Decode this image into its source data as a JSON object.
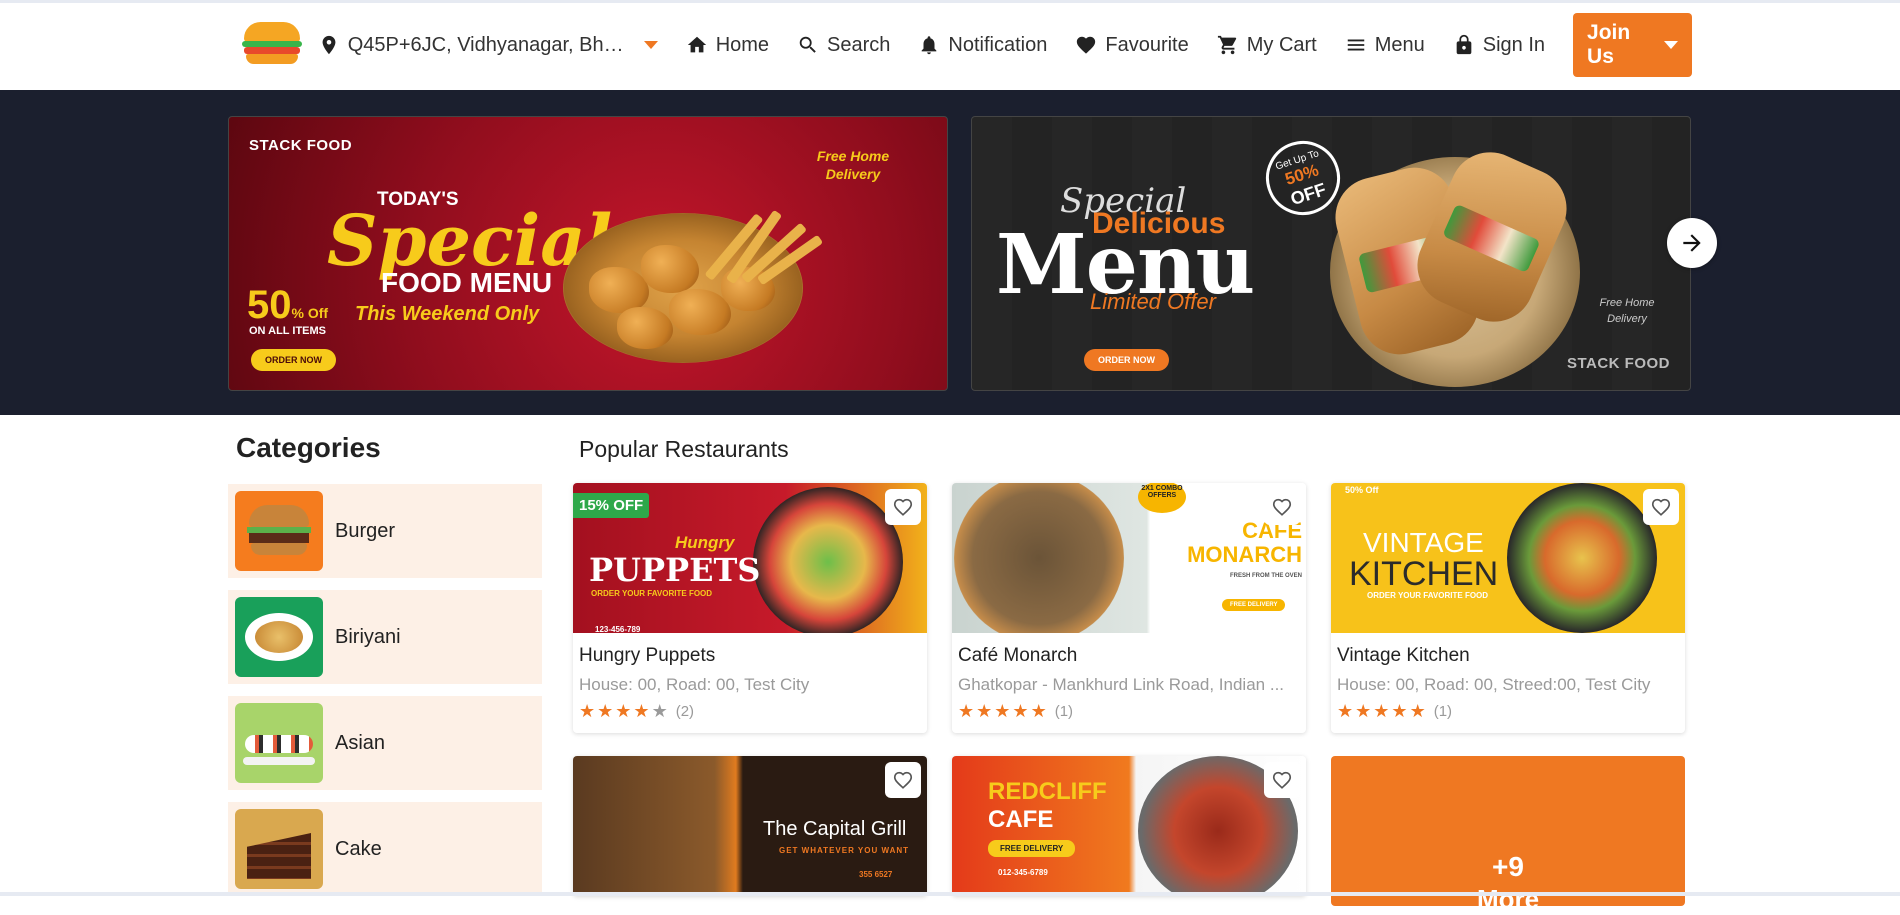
{
  "header": {
    "location": "Q45P+6JC, Vidhyanagar, Bhav...",
    "nav": {
      "home": "Home",
      "search": "Search",
      "notification": "Notification",
      "favourite": "Favourite",
      "cart": "My Cart",
      "menu": "Menu",
      "signin": "Sign In"
    },
    "join_label": "Join Us"
  },
  "banners": [
    {
      "brand": "STACK FOOD",
      "today": "TODAY'S",
      "special": "Special",
      "food_menu": "FOOD MENU",
      "weekend": "This Weekend Only",
      "discount": "50",
      "discount_suffix": "% Off",
      "all_items": "ON ALL ITEMS",
      "order": "ORDER NOW",
      "free_delivery": "Free Home Delivery"
    },
    {
      "special": "Special",
      "delicious": "Delicious",
      "menu": "Menu",
      "limited": "Limited Offer",
      "badge_top": "Get Up To",
      "badge_pct": "50%",
      "badge_off": "OFF",
      "order": "ORDER NOW",
      "free_delivery": "Free Home Delivery",
      "brand": "STACK FOOD"
    }
  ],
  "categories": {
    "title": "Categories",
    "items": [
      {
        "label": "Burger"
      },
      {
        "label": "Biriyani"
      },
      {
        "label": "Asian"
      },
      {
        "label": "Cake"
      }
    ]
  },
  "popular": {
    "title": "Popular Restaurants",
    "restaurants": [
      {
        "name": "Hungry Puppets",
        "address": "House: 00, Road: 00, Test City",
        "rating": 4.5,
        "count": "(2)",
        "badge": "15% OFF",
        "img_title": "PUPPETS",
        "img_script": "Hungry",
        "img_sub": "ORDER YOUR FAVORITE FOOD",
        "img_phone": "123-456-789"
      },
      {
        "name": "Café Monarch",
        "address": "Ghatkopar - Mankhurd Link Road, Indian ...",
        "rating": 5,
        "count": "(1)",
        "img_title": "CAFE MONARCH",
        "img_sub": "FRESH FROM THE OVEN",
        "img_badge": "2X1 COMBO OFFERS",
        "img_btn": "FREE DELIVERY"
      },
      {
        "name": "Vintage Kitchen",
        "address": "House: 00, Road: 00, Streed:00, Test City",
        "rating": 5,
        "count": "(1)",
        "img_title_1": "VINTAGE",
        "img_title_2": "KITCHEN",
        "img_sub": "ORDER YOUR FAVORITE FOOD",
        "img_top": "50% Off"
      },
      {
        "img_title": "The Capital Grill",
        "img_sub": "GET WHATEVER YOU WANT",
        "img_phone": "355 6527"
      },
      {
        "img_title_1": "REDCLIFF",
        "img_title_2": "CAFE",
        "img_btn": "FREE DELIVERY",
        "img_phone": "012-345-6789"
      }
    ],
    "more_count": "+9",
    "more_label": "More"
  },
  "colors": {
    "accent": "#ef7822",
    "banner_bg": "#1b1f2e",
    "category_bg": "#fdf0e6",
    "discount_badge": "#2ea84a"
  }
}
